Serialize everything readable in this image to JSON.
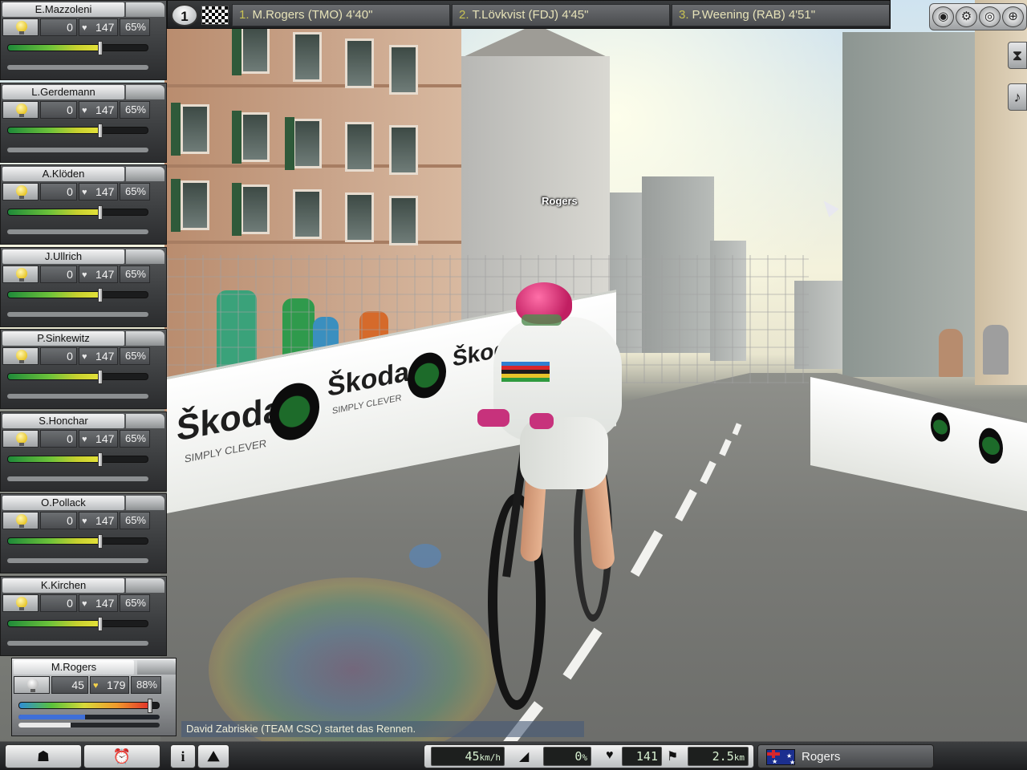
{
  "colors": {
    "panel": "#3d3f41",
    "panel_active": "#a9acae",
    "energy_bar_start": "#1f8a3a",
    "energy_bar_end": "#e5e23a",
    "standing_text": "#e6e2b8",
    "standing_number": "#c8c253",
    "readout_text": "#d7f0d0"
  },
  "scene": {
    "rider_tag": "Rogers",
    "banner_brand": "Škoda",
    "banner_slogan": "SIMPLY CLEVER"
  },
  "riders": [
    {
      "name": "E.Mazzoleni",
      "count": "0",
      "heart_rate": "147",
      "effort": "65%",
      "energy": 0.66
    },
    {
      "name": "L.Gerdemann",
      "count": "0",
      "heart_rate": "147",
      "effort": "65%",
      "energy": 0.66
    },
    {
      "name": "A.Klöden",
      "count": "0",
      "heart_rate": "147",
      "effort": "65%",
      "energy": 0.66
    },
    {
      "name": "J.Ullrich",
      "count": "0",
      "heart_rate": "147",
      "effort": "65%",
      "energy": 0.66
    },
    {
      "name": "P.Sinkewitz",
      "count": "0",
      "heart_rate": "147",
      "effort": "65%",
      "energy": 0.66
    },
    {
      "name": "S.Honchar",
      "count": "0",
      "heart_rate": "147",
      "effort": "65%",
      "energy": 0.66
    },
    {
      "name": "O.Pollack",
      "count": "0",
      "heart_rate": "147",
      "effort": "65%",
      "energy": 0.66
    },
    {
      "name": "K.Kirchen",
      "count": "0",
      "heart_rate": "147",
      "effort": "65%",
      "energy": 0.66
    }
  ],
  "active_rider": {
    "name": "M.Rogers",
    "count": "45",
    "heart_rate": "179",
    "effort": "88%",
    "energy": 0.93,
    "sub_bar": 0.47,
    "sub_bar2": 0.37
  },
  "topbar": {
    "position": "1",
    "standings": [
      {
        "rank": "1.",
        "text": "M.Rogers (TMO) 4'40\""
      },
      {
        "rank": "2.",
        "text": "T.Lövkvist (FDJ) 4'45\""
      },
      {
        "rank": "3.",
        "text": "P.Weening (RAB) 4'51\""
      }
    ]
  },
  "top_icons": [
    "eye-icon",
    "bike-icon",
    "wheel-icon",
    "world-icon"
  ],
  "side_icons": [
    {
      "name": "hourglass-icon",
      "glyph": "⧗"
    },
    {
      "name": "music-icon",
      "glyph": "♪"
    }
  ],
  "message": "David Zabriskie (TEAM CSC) startet das Rennen.",
  "bottombar": {
    "speed": "45",
    "speed_unit": "km/h",
    "slope": "0",
    "slope_unit": "%",
    "heart_rate": "141",
    "distance": "2.5",
    "distance_unit": "km",
    "nation_name": "Rogers",
    "info_label": "i"
  }
}
